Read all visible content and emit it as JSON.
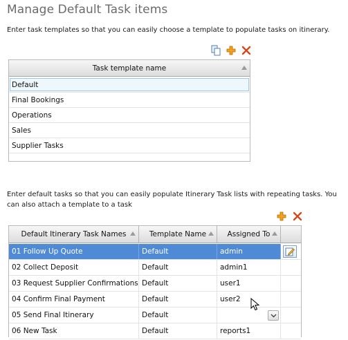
{
  "page": {
    "title": "Manage Default Task items",
    "templates_description": "Enter task templates so that you can easily choose a template to populate tasks on itinerary.",
    "tasks_description": "Enter default tasks so that you can easily populate Itinerary Task lists with repeating tasks. You can also attach a template to a task"
  },
  "templates_toolbar": {
    "icons": [
      "copy-icon",
      "add-icon",
      "delete-icon"
    ]
  },
  "templates_grid": {
    "header": "Task template name",
    "rows": [
      "Default",
      "Final Bookings",
      "Operations",
      "Sales",
      "Supplier Tasks"
    ],
    "editing_row": 0
  },
  "tasks_toolbar": {
    "icons": [
      "add-icon",
      "delete-icon"
    ]
  },
  "tasks_grid": {
    "headers": [
      "Default Itinerary Task Names",
      "Template Name",
      "Assigned To"
    ],
    "rows": [
      {
        "name": "01 Follow Up Quote",
        "template": "Default",
        "assigned": "admin"
      },
      {
        "name": "02 Collect Deposit",
        "template": "Default",
        "assigned": "admin1"
      },
      {
        "name": "03 Request Supplier Confirmations",
        "template": "Default",
        "assigned": "user1"
      },
      {
        "name": "04 Confirm Final Payment",
        "template": "Default",
        "assigned": "user2"
      },
      {
        "name": "05 Send Final Itinerary",
        "template": "Default",
        "assigned": ""
      },
      {
        "name": "06 New Task",
        "template": "Default",
        "assigned": "reports1"
      }
    ],
    "selected_row": 0
  },
  "colors": {
    "selected_row": "#4f8ad6",
    "add_icon": "#e08a00",
    "delete_icon": "#d24a1a"
  }
}
